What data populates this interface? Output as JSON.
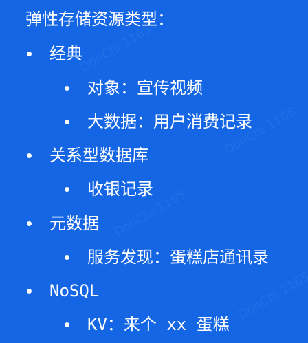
{
  "slide": {
    "heading": "弹性存储资源类型：",
    "items": [
      {
        "label": "经典",
        "children": [
          "对象：宣传视频",
          "大数据：用户消费记录"
        ]
      },
      {
        "label": "关系型数据库",
        "children": [
          "收银记录"
        ]
      },
      {
        "label": "元数据",
        "children": [
          "服务发现：蛋糕店通讯录"
        ]
      },
      {
        "label": "NoSQL",
        "children": [
          "KV：来个 xx 蛋糕"
        ]
      }
    ],
    "watermark": "DonChi 1165"
  }
}
